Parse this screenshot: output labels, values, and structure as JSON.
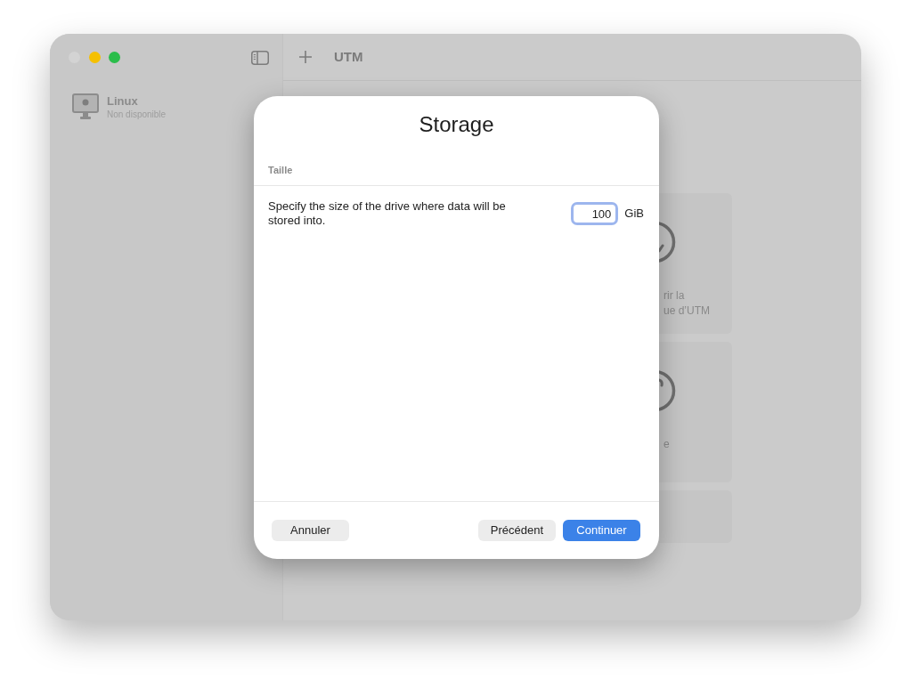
{
  "window": {
    "traffic_lights": [
      {
        "kind": "close",
        "disabled": true
      },
      {
        "kind": "minimize",
        "disabled": false
      },
      {
        "kind": "zoom",
        "disabled": false
      }
    ],
    "title": "UTM"
  },
  "sidebar": {
    "items": [
      {
        "name": "Linux",
        "status": "Non disponible"
      }
    ]
  },
  "content": {
    "cards": [
      {
        "kind": "icon_text",
        "lines": [
          "rir la",
          "ue d’UTM"
        ]
      },
      {
        "kind": "icon_text",
        "lines": [
          "e"
        ]
      },
      {
        "kind": "plain"
      }
    ]
  },
  "dialog": {
    "title": "Storage",
    "section": "Taille",
    "description": "Specify the size of the drive where data will be stored into.",
    "size_field": {
      "value": "100",
      "focused": true
    },
    "unit": "GiB",
    "buttons": [
      {
        "label": "Annuler",
        "kind": "cancel"
      },
      {
        "label": "Précédent",
        "kind": "secondary"
      },
      {
        "label": "Continuer",
        "kind": "primary"
      }
    ]
  }
}
